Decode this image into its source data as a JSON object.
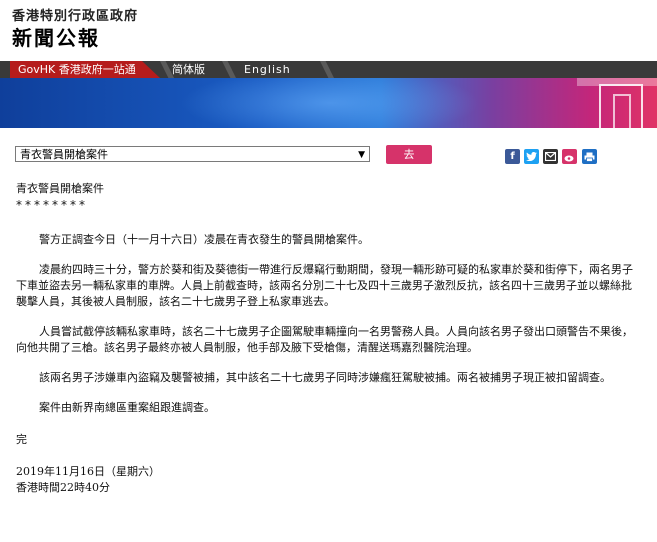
{
  "header": {
    "gov_name": "香港特別行政區政府",
    "title": "新聞公報"
  },
  "nav": {
    "govhk": "GovHK 香港政府一站通",
    "simplified": "简体版",
    "english": "English"
  },
  "toolbar": {
    "select_value": "青衣警員開槍案件",
    "go_label": "去",
    "share_icons": [
      "facebook-icon",
      "twitter-icon",
      "email-icon",
      "weibo-icon",
      "print-icon"
    ]
  },
  "colors": {
    "facebook": "#3b5998",
    "twitter": "#1da1f2",
    "email": "#333333",
    "weibo": "#d6336a",
    "print": "#1f6fc4",
    "go_button": "#d6336a",
    "nav_govhk": "#b51c1c"
  },
  "article": {
    "title": "青衣警員開槍案件",
    "stars": "********",
    "paragraphs": [
      "警方正調查今日（十一月十六日）凌晨在青衣發生的警員開槍案件。",
      "凌晨約四時三十分，警方於葵和街及葵德街一帶進行反爆竊行動期間，發現一輛形跡可疑的私家車於葵和街停下，兩名男子下車並盜去另一輛私家車的車牌。人員上前截查時，該兩名分別二十七及四十三歲男子激烈反抗，該名四十三歲男子並以螺絲批襲擊人員，其後被人員制服，該名二十七歲男子登上私家車逃去。",
      "人員嘗試截停該輛私家車時，該名二十七歲男子企圖駕駛車輛撞向一名男警務人員。人員向該名男子發出口頭警告不果後，向他共開了三槍。該名男子最終亦被人員制服，他手部及腋下受槍傷，清醒送瑪嘉烈醫院治理。",
      "該兩名男子涉嫌車內盜竊及襲警被捕，其中該名二十七歲男子同時涉嫌瘋狂駕駛被捕。兩名被捕男子現正被扣留調查。",
      "案件由新界南總區重案組跟進調查。"
    ],
    "end": "完",
    "date": "2019年11月16日（星期六）",
    "time": "香港時間22時40分"
  }
}
